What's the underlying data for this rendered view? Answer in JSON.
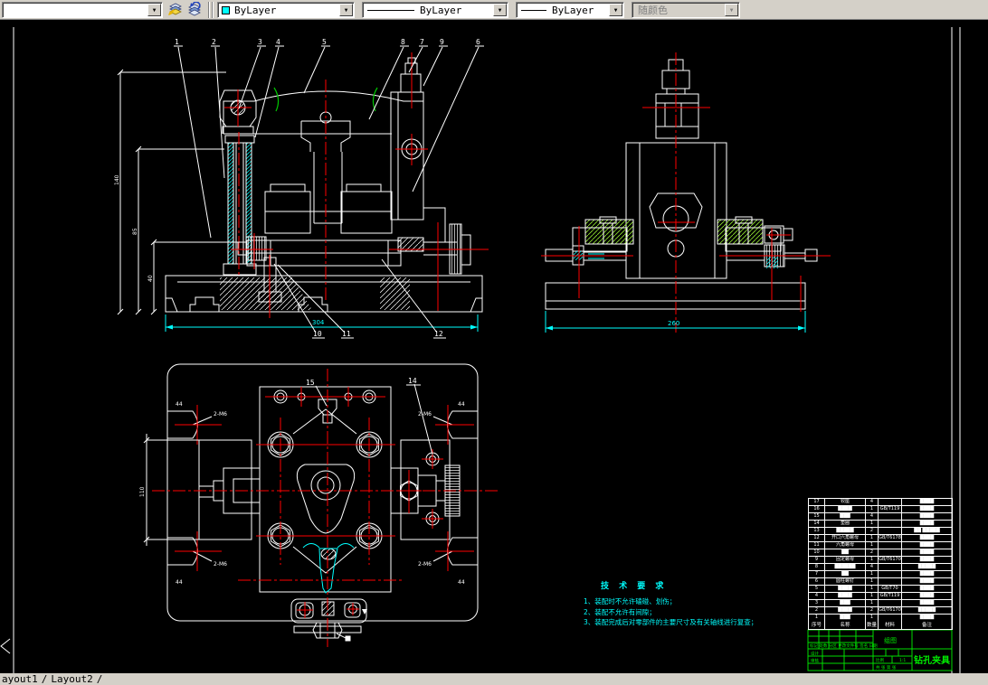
{
  "toolbar": {
    "layer_dropdown_value": "",
    "icons": [
      "make-object-layer-current",
      "layer-previous"
    ],
    "color_control": {
      "value": "ByLayer",
      "swatch": "#00ffff"
    },
    "linetype_control": {
      "value": "ByLayer"
    },
    "lineweight_control": {
      "value": "ByLayer"
    },
    "plotstyle_control": {
      "value": "随颜色",
      "disabled": true
    }
  },
  "canvas": {
    "background": "#000000",
    "colors": {
      "geometry": "#ffffff",
      "centerline": "#ff0000",
      "hatch_green": "#8fdf2f",
      "dimension_cyan": "#00ffff",
      "titleblock_green": "#00dd00"
    },
    "front_view": {
      "balloons": [
        "1",
        "2",
        "3",
        "4",
        "5",
        "8",
        "7",
        "9",
        "6",
        "10",
        "11",
        "12"
      ],
      "dims_left": [
        "140",
        "85",
        "40"
      ],
      "dim_bottom": "304"
    },
    "side_view": {
      "dim_bottom": "260"
    },
    "plan_view": {
      "balloons": [
        "15",
        "14"
      ],
      "dim_left": "110",
      "corner_dims": [
        "44",
        "44",
        "44",
        "44"
      ],
      "corner_labels": [
        "2-M6",
        "2-M6",
        "2-M6",
        "2-M6"
      ]
    },
    "tech_requirements": {
      "title": "技 术 要 求",
      "items": [
        "1、装配时不允许磕碰、划伤；",
        "2、装配不允许有间隙；",
        "3、装配完成后对零部件的主要尺寸及有关轴线进行复查；"
      ]
    }
  },
  "bom": {
    "headers": [
      "序号",
      "名称",
      "数量",
      "材料",
      "备注"
    ],
    "rows": [
      {
        "no": "17",
        "name": "铰座",
        "qty": "4",
        "std": "",
        "note": "▇▇▇▇"
      },
      {
        "no": "16",
        "name": "▇▇▇▇",
        "qty": "1",
        "std": "GB/T119",
        "note": "▇▇▇▇"
      },
      {
        "no": "15",
        "name": "▇▇▇",
        "qty": "4",
        "std": "",
        "note": "▇▇▇▇"
      },
      {
        "no": "14",
        "name": "垫圈",
        "qty": "1",
        "std": "",
        "note": "▇▇▇▇"
      },
      {
        "no": "13",
        "name": "▇▇▇▇▇",
        "qty": "2",
        "std": "",
        "note": "▇▇ ▇▇▇▇▇"
      },
      {
        "no": "12",
        "name": "开口六角螺母",
        "qty": "1",
        "std": "GB/T6178",
        "note": "▇▇▇▇"
      },
      {
        "no": "11",
        "name": "六角螺母",
        "qty": "1",
        "std": "",
        "note": "▇▇▇▇"
      },
      {
        "no": "10",
        "name": "▇▇",
        "qty": "2",
        "std": "",
        "note": "▇▇▇▇"
      },
      {
        "no": "9",
        "name": "固定螺母",
        "qty": "1",
        "std": "GB/T6170",
        "note": "▇▇▇▇"
      },
      {
        "no": "8",
        "name": "▇▇▇▇▇▇",
        "qty": "4",
        "std": "",
        "note": "▇▇▇▇▇"
      },
      {
        "no": "7",
        "name": "▇▇",
        "qty": "1",
        "std": "",
        "note": "▇▇▇▇"
      },
      {
        "no": "6",
        "name": "圆柱螺钉",
        "qty": "1",
        "std": "",
        "note": "▇▇▇▇"
      },
      {
        "no": "5",
        "name": "▇▇▇▇",
        "qty": "1",
        "std": "GB/T70",
        "note": "▇▇▇▇"
      },
      {
        "no": "4",
        "name": "▇▇▇▇",
        "qty": "1",
        "std": "GB/T119",
        "note": "▇▇▇▇"
      },
      {
        "no": "3",
        "name": "▇▇▇",
        "qty": "1",
        "std": "",
        "note": "▇▇▇▇"
      },
      {
        "no": "2",
        "name": "▇▇▇▇",
        "qty": "2",
        "std": "GB/T6170",
        "note": "▇▇▇▇▇"
      },
      {
        "no": "1",
        "name": "▇▇▇",
        "qty": "1",
        "std": "",
        "note": "▇▇▇▇"
      }
    ]
  },
  "titleblock": {
    "doc_type": "组图",
    "title": "钻孔夹具",
    "scale_label": "比例",
    "scale": "1:1",
    "mark_row": "标记 处数 分区 更改文件号 签名 日期",
    "left_labels": [
      "设计",
      "审核"
    ],
    "sheet_label": "共 张 第 张"
  },
  "tabs": {
    "items": [
      "ayout1",
      "Layout2"
    ]
  }
}
